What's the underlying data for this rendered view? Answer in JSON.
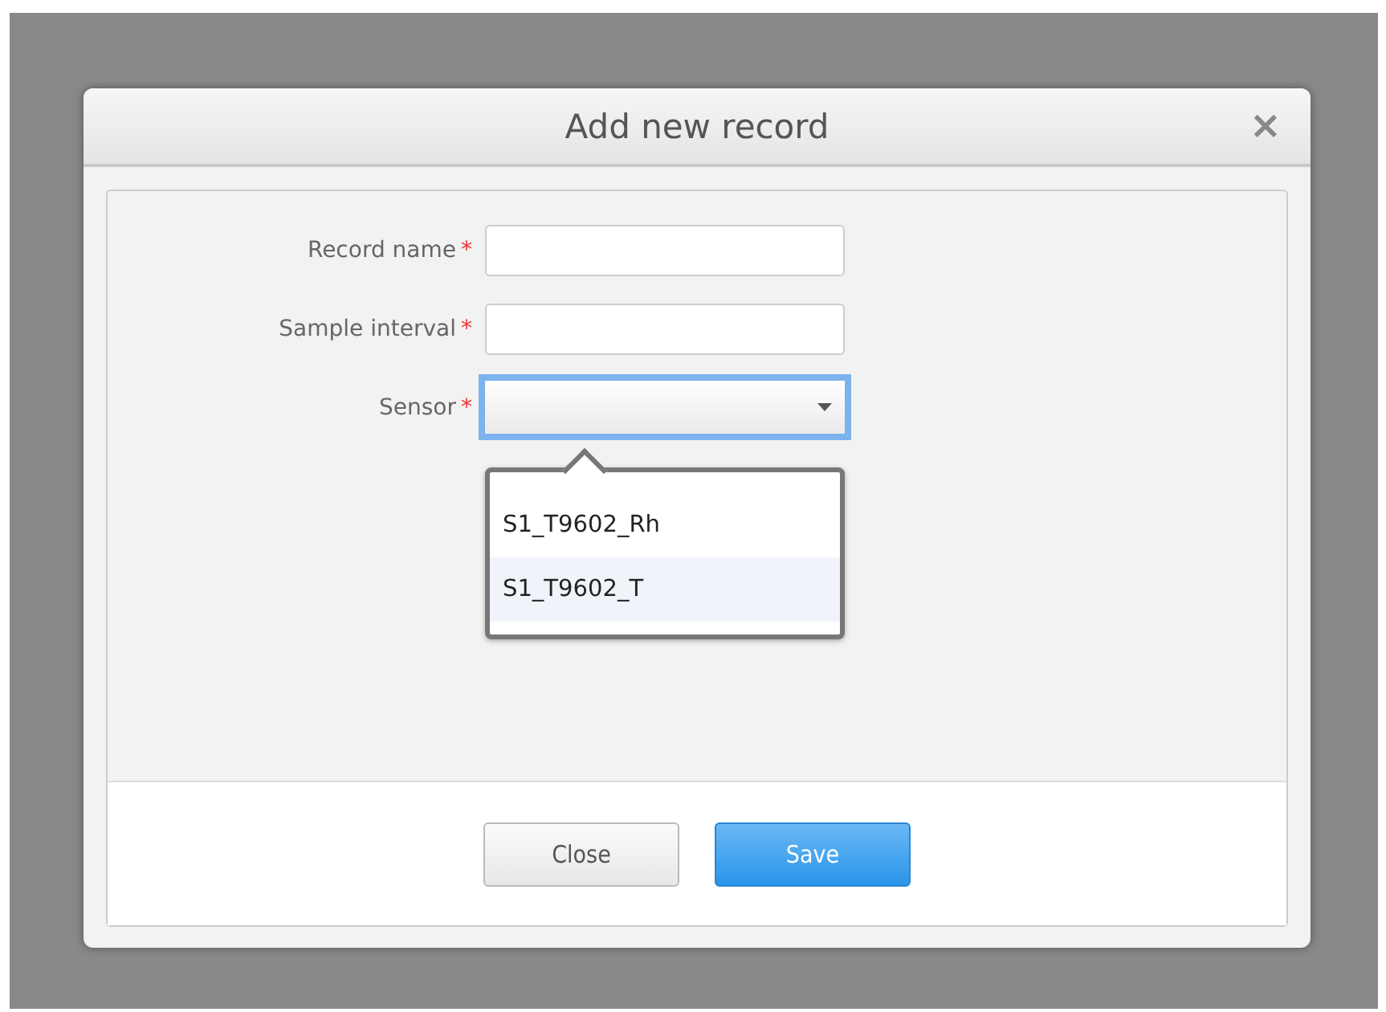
{
  "dialog": {
    "title": "Add new record",
    "close_icon": "×"
  },
  "fields": [
    {
      "kind": "text",
      "label": "Record name",
      "required_mark": "*",
      "focused": false
    },
    {
      "kind": "text",
      "label": "Sample interval",
      "required_mark": "*",
      "focused": false
    },
    {
      "kind": "select",
      "label": "Sensor",
      "required_mark": "*",
      "focused": true,
      "expanded": true,
      "options": [
        {
          "label": "S1_T9602_Rh",
          "selected": false
        },
        {
          "label": "S1_T9602_T",
          "selected": true
        }
      ]
    }
  ],
  "buttons": [
    {
      "label": "Close",
      "kind": "secondary"
    },
    {
      "label": "Save",
      "kind": "primary"
    }
  ]
}
